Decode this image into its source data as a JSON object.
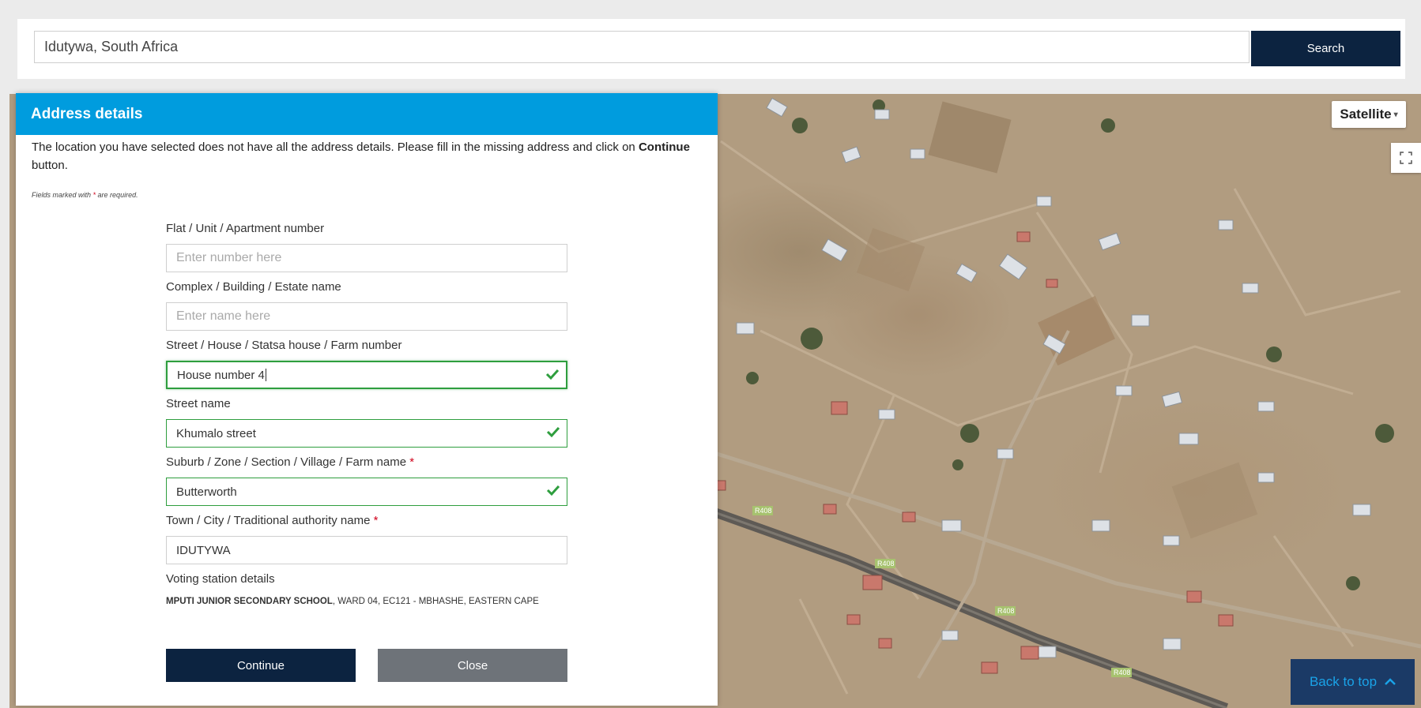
{
  "search": {
    "value": "Idutywa, South Africa",
    "button_label": "Search"
  },
  "map": {
    "type_label": "Satellite",
    "road_labels": [
      "R408",
      "R408",
      "R408",
      "R408"
    ]
  },
  "modal": {
    "title": "Address details",
    "intro_text": "The location you have selected does not have all the address details. Please fill in the missing address and click on ",
    "intro_bold": "Continue",
    "intro_end": " button.",
    "required_note_pre": "Fields marked with ",
    "required_star": "*",
    "required_note_post": " are required.",
    "fields": [
      {
        "label": "Flat / Unit / Apartment number",
        "placeholder": "Enter number here",
        "value": "",
        "required": false
      },
      {
        "label": "Complex / Building / Estate name",
        "placeholder": "Enter name here",
        "value": "",
        "required": false
      },
      {
        "label": "Street / House / Statsa house / Farm number",
        "placeholder": "",
        "value": "House number 4",
        "required": false
      },
      {
        "label": "Street name",
        "placeholder": "",
        "value": "Khumalo street",
        "required": false
      },
      {
        "label": "Suburb / Zone / Section / Village / Farm name ",
        "placeholder": "",
        "value": "Butterworth",
        "required": true
      },
      {
        "label": "Town / City / Traditional authority name ",
        "placeholder": "",
        "value": "IDUTYWA",
        "required": true
      }
    ],
    "voting_station_label": "Voting station details",
    "voting_station_name": "MPUTI JUNIOR SECONDARY SCHOOL",
    "voting_station_rest": ", WARD 04, EC121 - MBHASHE, EASTERN CAPE",
    "continue_label": "Continue",
    "close_label": "Close"
  },
  "back_to_top": "Back to top",
  "colors": {
    "header_blue": "#009cde",
    "navy": "#0c2340",
    "valid_green": "#2e9e3e",
    "required_red": "#d0021b",
    "close_grey": "#6e7379"
  }
}
